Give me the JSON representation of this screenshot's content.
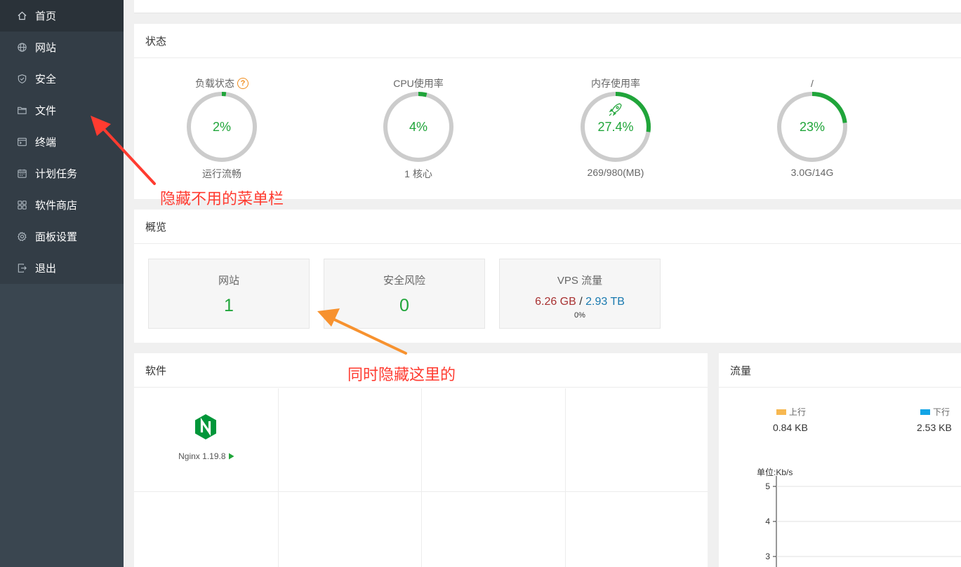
{
  "sidebar": {
    "items": [
      {
        "label": "首页",
        "icon": "home-icon",
        "active": true
      },
      {
        "label": "网站",
        "icon": "globe-icon"
      },
      {
        "label": "安全",
        "icon": "shield-icon"
      },
      {
        "label": "文件",
        "icon": "folder-icon"
      },
      {
        "label": "终端",
        "icon": "terminal-icon"
      },
      {
        "label": "计划任务",
        "icon": "calendar-icon"
      },
      {
        "label": "软件商店",
        "icon": "grid-icon"
      },
      {
        "label": "面板设置",
        "icon": "gear-icon"
      },
      {
        "label": "退出",
        "icon": "logout-icon"
      }
    ]
  },
  "status": {
    "title": "状态",
    "gauges": [
      {
        "label": "负载状态",
        "value": "2%",
        "percent": 2,
        "sub": "运行流畅",
        "help": "?"
      },
      {
        "label": "CPU使用率",
        "value": "4%",
        "percent": 4,
        "sub": "1 核心"
      },
      {
        "label": "内存使用率",
        "value": "27.4%",
        "percent": 27.4,
        "sub": "269/980(MB)",
        "icon": "rocket-icon"
      },
      {
        "label": "/",
        "value": "23%",
        "percent": 23,
        "sub": "3.0G/14G"
      }
    ]
  },
  "overview": {
    "title": "概览",
    "cards": {
      "sites": {
        "title": "网站",
        "value": "1"
      },
      "risks": {
        "title": "安全风险",
        "value": "0"
      },
      "vps": {
        "title": "VPS 流量",
        "used": "6.26 GB",
        "sep": "/",
        "total": "2.93 TB",
        "percent": "0%"
      }
    }
  },
  "software": {
    "title": "软件",
    "items": [
      {
        "name": "Nginx 1.19.8",
        "icon": "nginx-icon"
      }
    ]
  },
  "flow": {
    "title": "流量",
    "up_label": "上行",
    "down_label": "下行",
    "up_value": "0.84 KB",
    "down_value": "2.53 KB",
    "unit": "单位:Kb/s",
    "y_ticks": [
      "5",
      "4",
      "3"
    ]
  },
  "annotations": {
    "menu_note": "隐藏不用的菜单栏",
    "overview_note": "同时隐藏这里的"
  },
  "colors": {
    "accent": "#20a53a",
    "sidebar_bg": "#3a4650",
    "menu_bg": "#333d46",
    "annotation_red": "#ff3b30",
    "annotation_orange": "#f7922f",
    "traffic_used": "#a83232",
    "traffic_total": "#1a7ab0",
    "flow_up": "#f7b851",
    "flow_down": "#12a4e6"
  }
}
